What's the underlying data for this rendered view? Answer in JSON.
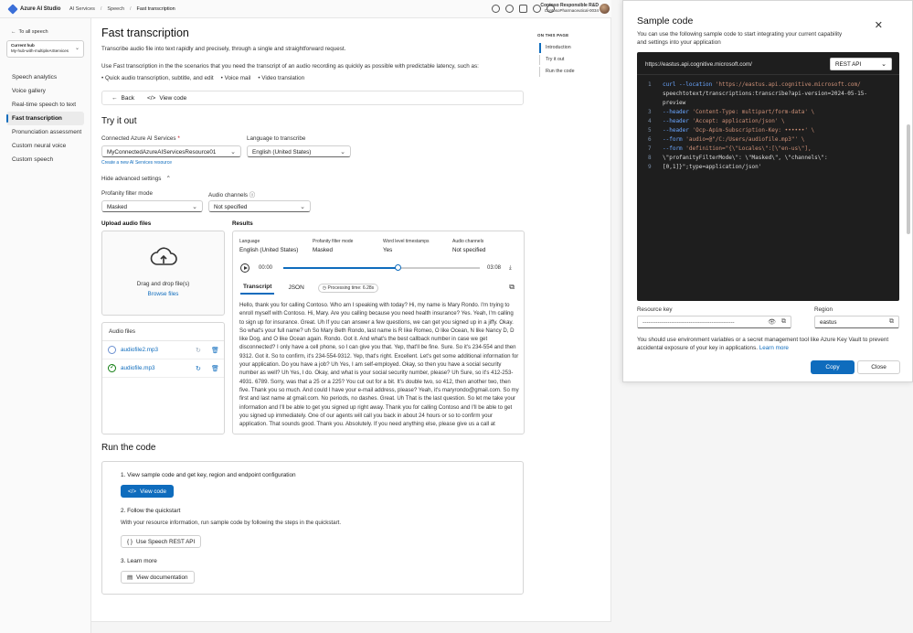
{
  "topbar": {
    "brand": "Azure AI Studio",
    "crumbs": [
      "AI Services",
      "Speech",
      "Fast transcription"
    ],
    "user_name": "Contoso Responsible R&D",
    "user_org": "ContosoPharmaceutical-0034"
  },
  "sidebar": {
    "back": "To all speech",
    "hub_label": "Current hub",
    "hub_value": "My-hub-with-multipleAIServices",
    "items": [
      {
        "label": "Speech analytics"
      },
      {
        "label": "Voice gallery"
      },
      {
        "label": "Real-time speech to text"
      },
      {
        "label": "Fast transcription"
      },
      {
        "label": "Pronunciation assessment"
      },
      {
        "label": "Custom neural voice"
      },
      {
        "label": "Custom speech"
      }
    ]
  },
  "main": {
    "title": "Fast transcription",
    "desc1": "Transcribe audio file into text rapidly and precisely, through a single and straightforward request.",
    "desc2": "Use Fast transcription in the the scenarios that you need the transcript of an audio recording as quickly as possible with predictable latency, such as:",
    "bullets": [
      "Quick audio transcription, subtitle, and edit",
      "Voice mail",
      "Video translation"
    ],
    "back_button": "Back",
    "view_code_button": "View code",
    "toc": {
      "head": "ON THIS PAGE",
      "items": [
        "Introduction",
        "Try it out",
        "Run the code"
      ]
    },
    "try": {
      "heading": "Try it out",
      "connected_label": "Connected Azure AI Services",
      "connected_value": "MyConnectedAzureAIServicesResource01",
      "create_link": "Create a new AI Services resource",
      "lang_label": "Language to transcribe",
      "lang_value": "English (United States)",
      "advanced_toggle": "Hide advanced settings",
      "profanity_label": "Profanity filter mode",
      "profanity_value": "Masked",
      "channels_label": "Audio channels",
      "channels_value": "Not specified"
    },
    "upload": {
      "heading": "Upload audio files",
      "drag_text": "Drag and drop file(s)",
      "browse": "Browse files",
      "list_heading": "Audio files",
      "files": [
        {
          "name": "audiofile2.mp3",
          "status": "processing"
        },
        {
          "name": "audiofile.mp3",
          "status": "done"
        }
      ]
    },
    "results": {
      "heading": "Results",
      "meta": [
        {
          "label": "Language",
          "value": "English (United States)"
        },
        {
          "label": "Profanity filter mode",
          "value": "Masked"
        },
        {
          "label": "Word level timestamps",
          "value": "Yes"
        },
        {
          "label": "Audio channels",
          "value": "Not specified"
        }
      ],
      "time_current": "00:00",
      "time_total": "03:08",
      "progress_fraction": 0.58,
      "tabs": [
        "Transcript",
        "JSON"
      ],
      "processing": "Processing time: 6.28s",
      "transcript": "Hello, thank you for calling Contoso. Who am I speaking with today? Hi, my name is Mary Rondo. I'm trying to enroll myself with Contoso. Hi, Mary. Are you calling because you need health insurance? Yes. Yeah, I'm calling to sign up for insurance. Great. Uh If you can answer a few questions, we can get you signed up in a jiffy. Okay. So what's your full name? uh So Mary Beth Rondo, last name is R like Romeo, O like Ocean, N like Nancy D, D like Dog, and O like Ocean again. Rondo. Got it. And what's the best callback number in case we get disconnected? I only have a cell phone, so I can give you that. Yep, that'll be fine. Sure. So it's 234-554 and then 9312. Got it. So to confirm, it's 234-554-9312. Yep, that's right. Excellent. Let's get some additional information for your application. Do you have a job? Uh Yes, I am self-employed. Okay, so then you have a social security number as well? Uh Yes, I do. Okay, and what is your social security number, please? Uh Sure, so it's 412-253-4931. 6789. Sorry, was that a 25 or a 225? You cut out for a bit. It's double two, so 412, then another two, then five. Thank you so much. And could I have your e-mail address, please? Yeah, it's maryrondo@gmail.com. So my first and last name at gmail.com. No periods, no dashes. Great. Uh That is the last question. So let me take your information and I'll be able to get you signed up right away. Thank you for calling Contoso and I'll be able to get you signed up immediately. One of our agents will call you back in about 24 hours or so to confirm your application. That sounds good. Thank you. Absolutely. If you need anything else, please give us a call at"
    },
    "run": {
      "heading": "Run the code",
      "step1": "1.  View sample code and get key, region and endpoint configuration",
      "step1_button": "View code",
      "step2": "2.  Follow the quickstart",
      "step2_text": "With your resource information, run sample code by following the steps in the quickstart.",
      "step2_button": "Use Speech REST API",
      "step3": "3.  Learn more",
      "step3_button": "View documentation"
    }
  },
  "panel": {
    "title": "Sample code",
    "desc": "You can use the following sample code to start integrating your current capability and settings into your application",
    "endpoint": "https://eastus.api.cognitive.microsoft.com/",
    "api_type": "REST API",
    "code_lines": [
      {
        "n": "1",
        "kw": "curl --location ",
        "rest": "'https://eastus.api.cognitive.microsoft.com/"
      },
      {
        "n": "",
        "kw": "",
        "rest": "speechtotext/transcriptions:transcribe?api-version=2024-05-15-"
      },
      {
        "n": "",
        "kw": "",
        "rest": "preview"
      },
      {
        "n": "3",
        "kw": "--header ",
        "rest": "'Content-Type: multipart/form-data' \\"
      },
      {
        "n": "4",
        "kw": "--header ",
        "rest": "'Accept: application/json' \\"
      },
      {
        "n": "5",
        "kw": "--header ",
        "rest": "'Ocp-Apim-Subscription-Key: ••••••' \\"
      },
      {
        "n": "6",
        "kw": "--form ",
        "rest": "'audio=@\"/C:/Users/audiofile.mp3\"' \\"
      },
      {
        "n": "7",
        "kw": "--form ",
        "rest": "'definition=\"{\\\"Locales\\\":[\\\"en-us\\\"],"
      },
      {
        "n": "8",
        "kw": "",
        "rest": "\\\"profanityFilterMode\\\": \\\"Masked\\\", \\\"channels\\\":"
      },
      {
        "n": "9",
        "kw": "",
        "rest": "[0,1]}\";type=application/json'"
      }
    ],
    "resource_key_label": "Resource key",
    "resource_key_value": "------------------------------------------------",
    "region_label": "Region",
    "region_value": "eastus",
    "note": "You should use environment variables or a secret management tool like Azure Key Vault to prevent accidental exposure of your key in applications.",
    "note_link": "Learn more",
    "copy_button": "Copy",
    "close_button": "Close"
  },
  "colors": {
    "accent": "#0f6cbd",
    "code_bg": "#1e1e1e"
  }
}
